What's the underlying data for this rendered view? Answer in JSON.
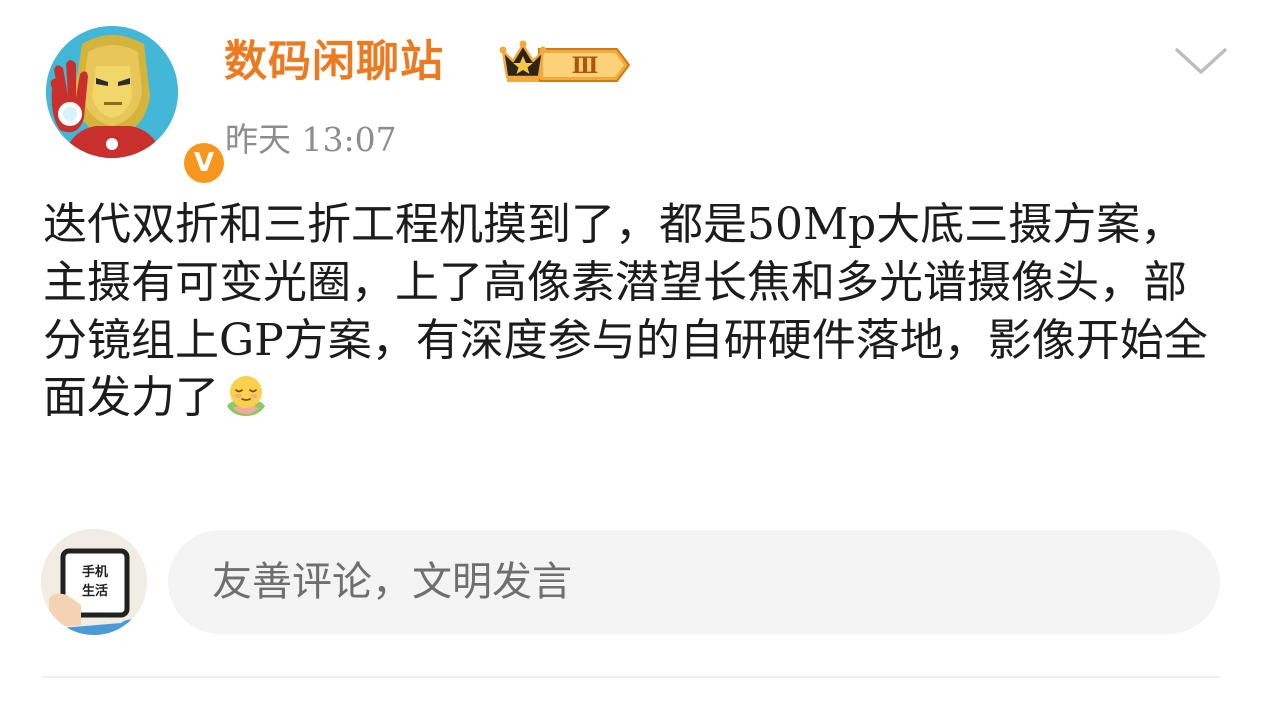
{
  "post": {
    "author": {
      "name": "数码闲聊站",
      "level_badge": "Ⅲ",
      "verified_mark": "V",
      "avatar_icon": "iron-man-avatar-icon"
    },
    "timestamp": "昨天 13:07",
    "text": "迭代双折和三折工程机摸到了，都是50Mp大底三摄方案，主摄有可变光圈，上了高像素潜望长焦和多光谱摄像头，部分镜组上GP方案，有深度参与的自研硬件落地，影像开始全面发力了",
    "emoji_icon": "zen-face-emoji-icon"
  },
  "comment_box": {
    "user_avatar_text_1": "手机",
    "user_avatar_text_2": "生活",
    "placeholder": "友善评论，文明发言"
  },
  "colors": {
    "author_name": "#ec7a21",
    "verified_badge": "#f7961d",
    "timestamp": "#8d8d8d",
    "body_text": "#1c1c1c",
    "input_bg": "#f4f4f4",
    "placeholder": "#6f6f6f"
  }
}
